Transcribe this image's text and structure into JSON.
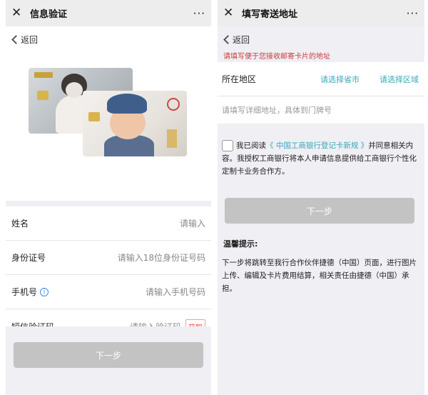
{
  "left": {
    "title": "信息验证",
    "more": "···",
    "back": "返回",
    "fields": [
      {
        "label": "姓名",
        "placeholder": "请输入"
      },
      {
        "label": "身份证号",
        "placeholder": "请输入18位身份证号码"
      },
      {
        "label": "手机号",
        "placeholder": "请输入手机号码"
      },
      {
        "label": "短信验证码",
        "placeholder": "请输入验证码",
        "button": "获取"
      }
    ],
    "next": "下一步"
  },
  "right": {
    "title": "填写寄送地址",
    "more": "···",
    "back": "返回",
    "notice": "请填写便于您接收邮寄卡片的地址",
    "region_label": "所在地区",
    "pick_province": "请选择省市",
    "pick_district": "请选择区域",
    "address_placeholder": "请填写详细地址，具体到门牌号",
    "agree_prefix": "我已阅读",
    "agree_link": "《 中国工商银行登记卡新规 》",
    "agree_suffix": "并同意相关内容。我授权工商银行将本人申请信息提供给工商银行个性化定制卡业务合作方。",
    "next": "下一步",
    "tip_title": "温馨提示:",
    "tip_text": "下一步将跳转至我行合作伙伴捷德（中国）页面，进行图片上传、编辑及卡片费用结算，相关责任由捷德（中国）承担。"
  },
  "colors": {
    "accent": "#38a8b8",
    "notice": "#c93c3c",
    "disabled_button": "#c3c3c3"
  }
}
